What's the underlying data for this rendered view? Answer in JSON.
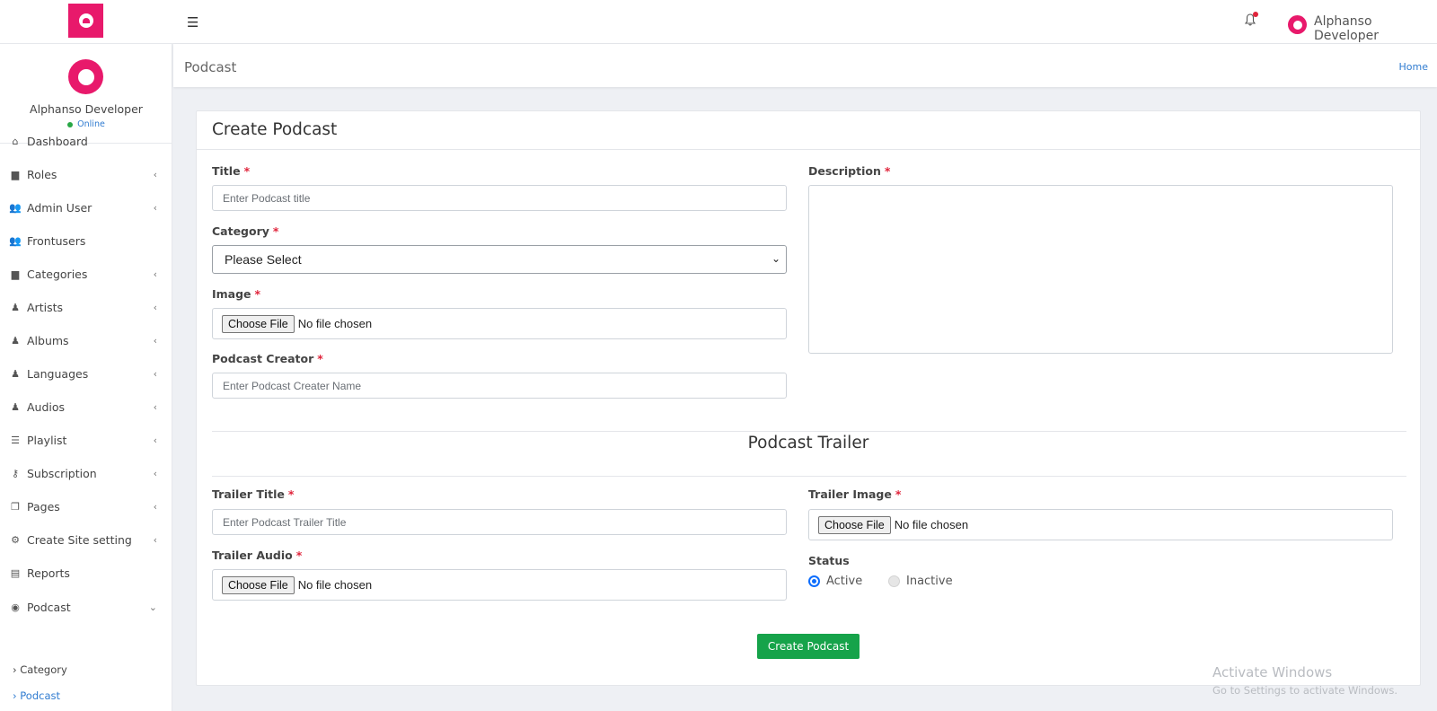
{
  "topbar": {
    "user_name": "Alphanso Developer"
  },
  "sidebar": {
    "profile_name": "Alphanso Developer",
    "profile_status": "Online",
    "items": [
      {
        "label": "Dashboard",
        "icon": "home-icon",
        "chevron": ""
      },
      {
        "label": "Roles",
        "icon": "briefcase-icon",
        "chevron": "‹"
      },
      {
        "label": "Admin User",
        "icon": "users-icon",
        "chevron": "‹"
      },
      {
        "label": "Frontusers",
        "icon": "users-icon",
        "chevron": ""
      },
      {
        "label": "Categories",
        "icon": "briefcase-icon",
        "chevron": "‹"
      },
      {
        "label": "Artists",
        "icon": "person-icon",
        "chevron": "‹"
      },
      {
        "label": "Albums",
        "icon": "person-icon",
        "chevron": "‹"
      },
      {
        "label": "Languages",
        "icon": "person-icon",
        "chevron": "‹"
      },
      {
        "label": "Audios",
        "icon": "person-icon",
        "chevron": "‹"
      },
      {
        "label": "Playlist",
        "icon": "list-icon",
        "chevron": "‹"
      },
      {
        "label": "Subscription",
        "icon": "key-icon",
        "chevron": "‹"
      },
      {
        "label": "Pages",
        "icon": "pages-icon",
        "chevron": "‹"
      },
      {
        "label": "Create Site setting",
        "icon": "gears-icon",
        "chevron": "‹"
      },
      {
        "label": "Reports",
        "icon": "file-excel-icon",
        "chevron": ""
      },
      {
        "label": "Podcast",
        "icon": "podcast-icon",
        "chevron": "⌄"
      }
    ],
    "sub_items": [
      {
        "label": "› Category"
      },
      {
        "label": "› Podcast"
      }
    ]
  },
  "header": {
    "page_title": "Podcast",
    "breadcrumb_home": "Home"
  },
  "form": {
    "card_title": "Create Podcast",
    "title_label": "Title",
    "title_placeholder": "Enter Podcast title",
    "category_label": "Category",
    "category_value": "Please Select",
    "image_label": "Image",
    "creator_label": "Podcast Creator",
    "creator_placeholder": "Enter Podcast Creater Name",
    "description_label": "Description",
    "file_button": "Choose File",
    "file_none": "No file chosen",
    "required_mark": "*",
    "trailer_section_title": "Podcast Trailer",
    "trailer_title_label": "Trailer Title",
    "trailer_title_placeholder": "Enter Podcast Trailer Title",
    "trailer_audio_label": "Trailer Audio",
    "trailer_image_label": "Trailer Image",
    "status_label": "Status",
    "status_active": "Active",
    "status_inactive": "Inactive",
    "submit_label": "Create Podcast"
  },
  "watermark": {
    "line1": "Activate Windows",
    "line2": "Go to Settings to activate Windows."
  },
  "colors": {
    "brand": "#e8196b",
    "link": "#2f7bd0",
    "submit": "#16a34a",
    "required": "#e0243b"
  }
}
